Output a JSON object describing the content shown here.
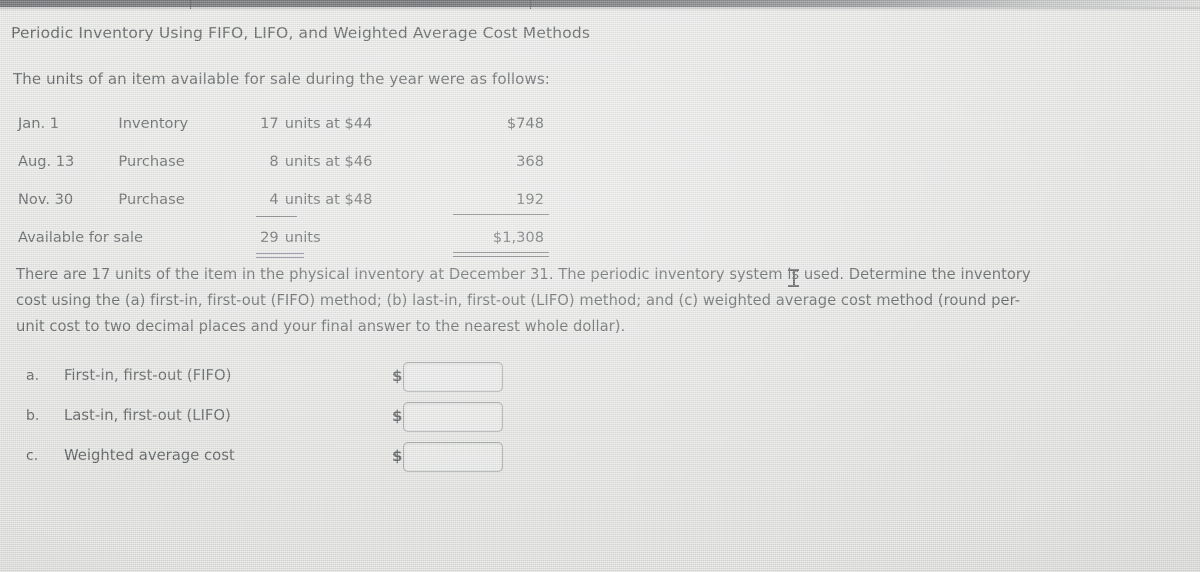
{
  "problem": {
    "heading": "Periodic Inventory Using FIFO, LIFO, and Weighted Average Cost Methods",
    "subheading": "The units of an item available for sale during the year were as follows:"
  },
  "inventory_table": {
    "rows": [
      {
        "date": "Jan. 1",
        "description": "Inventory",
        "quantity": "17",
        "units_text": "units at $44",
        "amount": "$748"
      },
      {
        "date": "Aug. 13",
        "description": "Purchase",
        "quantity": "8",
        "units_text": "units at $46",
        "amount": "368"
      },
      {
        "date": "Nov. 30",
        "description": "Purchase",
        "quantity": "4",
        "units_text": "units at $48",
        "amount": "192"
      }
    ],
    "total": {
      "label": "Available for sale",
      "quantity": "29",
      "units_text": "units",
      "amount": "$1,308"
    }
  },
  "requirement": {
    "line1": "There are 17 units of the item in the physical inventory at December 31. The periodic inventory system is used. Determine the inventory",
    "line2": "cost using the (a) first-in, first-out (FIFO) method; (b) last-in, first-out (LIFO) method; and (c) weighted average cost method (round per-",
    "line3": "unit cost to two decimal places and your final answer to the nearest whole dollar)."
  },
  "answers": {
    "currency_symbol": "$",
    "items": [
      {
        "letter": "a.",
        "label": "First-in, first-out (FIFO)",
        "value": "",
        "placeholder": ""
      },
      {
        "letter": "b.",
        "label": "Last-in, first-out (LIFO)",
        "value": "",
        "placeholder": ""
      },
      {
        "letter": "c.",
        "label": "Weighted average cost",
        "value": "",
        "placeholder": ""
      }
    ]
  },
  "colors": {
    "page_background": "#e4e4e2",
    "text": "#2b2f31",
    "rule": "#565a5d",
    "input_border": "#8f9295",
    "input_fill": "#e7e8e6",
    "bezel": "#4a4e50"
  }
}
